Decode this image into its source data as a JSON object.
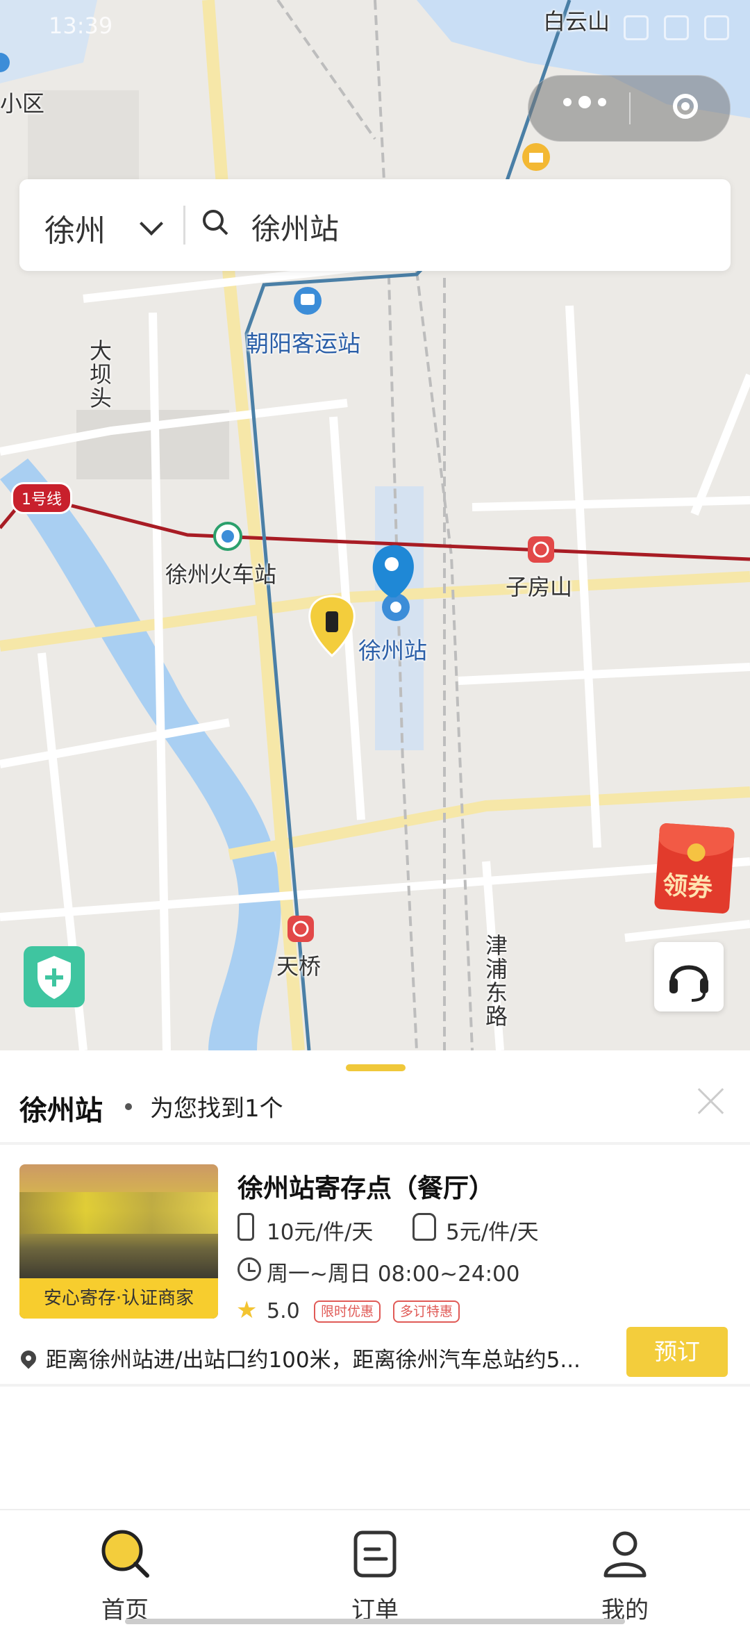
{
  "status": {
    "time": "13:39"
  },
  "search": {
    "city": "徐州",
    "query": "徐州站"
  },
  "map": {
    "labels": {
      "baiyunshan": "白云山",
      "xiaoqu": "小区",
      "chaoyang": "朝阳客运站",
      "daba": "大坝头",
      "line1": "1号线",
      "xuzhou_train": "徐州火车站",
      "zifangshan": "子房山",
      "xuzhou_station": "徐州站",
      "tianqiao": "天桥",
      "jinpu": "津浦东路"
    },
    "coupon_label": "领券"
  },
  "results": {
    "title": "徐州站",
    "count_text": "为您找到1个",
    "items": [
      {
        "name": "徐州站寄存点（餐厅）",
        "price_luggage": "10元/件/天",
        "price_bag": "5元/件/天",
        "hours": "周一~周日 08:00~24:00",
        "rating": "5.0",
        "tags": [
          "限时优惠",
          "多订特惠"
        ],
        "cert": "安心寄存·认证商家",
        "address": "距离徐州站进/出站口约100米，距离徐州汽车总站约5...",
        "book_label": "预订"
      }
    ]
  },
  "tabs": [
    {
      "label": "首页",
      "icon": "home-search-icon",
      "active": true
    },
    {
      "label": "订单",
      "icon": "order-icon",
      "active": false
    },
    {
      "label": "我的",
      "icon": "profile-icon",
      "active": false
    }
  ],
  "colors": {
    "accent": "#f3cd3c",
    "metro": "#c8202c",
    "river": "#a9cff2"
  }
}
